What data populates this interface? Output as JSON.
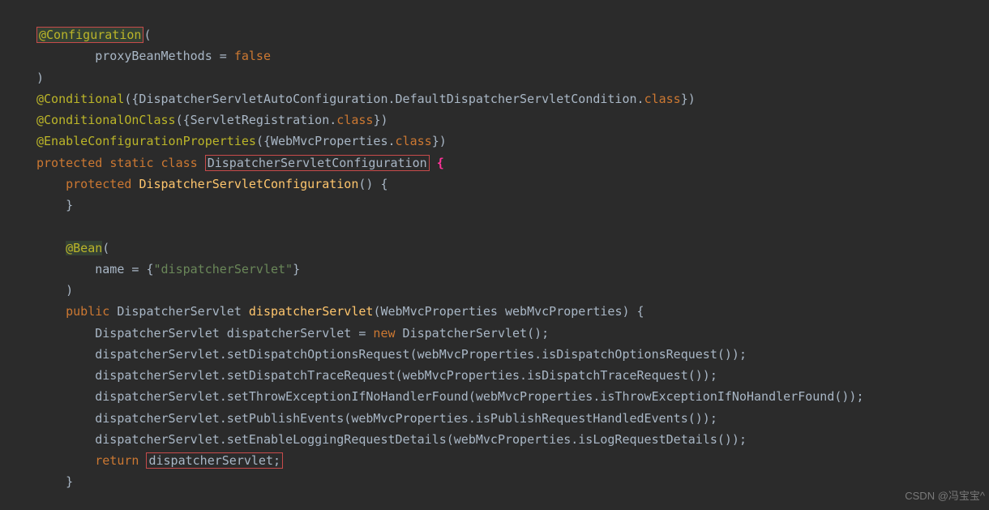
{
  "line1": {
    "annotation": "@Configuration",
    "paren": "("
  },
  "line2": {
    "indent": "        ",
    "prop": "proxyBeanMethods = ",
    "value": "false"
  },
  "line3": {
    "paren": ")"
  },
  "line4": {
    "annotation": "@Conditional",
    "rest": "({DispatcherServletAutoConfiguration.DefaultDispatcherServletCondition.",
    "cls": "class",
    "close": "})"
  },
  "line5": {
    "annotation": "@ConditionalOnClass",
    "rest": "({ServletRegistration.",
    "cls": "class",
    "close": "})"
  },
  "line6": {
    "annotation": "@EnableConfigurationProperties",
    "rest": "({WebMvcProperties.",
    "cls": "class",
    "close": "})"
  },
  "line7": {
    "kw1": "protected",
    "kw2": "static",
    "kw3": "class",
    "name": "DispatcherServletConfiguration",
    "brace": "{"
  },
  "line8": {
    "indent": "    ",
    "kw": "protected",
    "method": "DispatcherServletConfiguration",
    "rest": "() {"
  },
  "line9": {
    "indent": "    ",
    "brace": "}"
  },
  "line11": {
    "indent": "    ",
    "annotation": "@Bean",
    "paren": "("
  },
  "line12": {
    "indent": "        ",
    "prop": "name = {",
    "str": "\"dispatcherServlet\"",
    "close": "}"
  },
  "line13": {
    "indent": "    ",
    "paren": ")"
  },
  "line14": {
    "indent": "    ",
    "kw": "public",
    "type": "DispatcherServlet",
    "method": "dispatcherServlet",
    "params": "(WebMvcProperties webMvcProperties) {"
  },
  "line15": {
    "indent": "        ",
    "type": "DispatcherServlet dispatcherServlet = ",
    "kw": "new",
    "rest": " DispatcherServlet();"
  },
  "line16": {
    "indent": "        ",
    "text": "dispatcherServlet.setDispatchOptionsRequest(webMvcProperties.isDispatchOptionsRequest());"
  },
  "line17": {
    "indent": "        ",
    "text": "dispatcherServlet.setDispatchTraceRequest(webMvcProperties.isDispatchTraceRequest());"
  },
  "line18": {
    "indent": "        ",
    "text": "dispatcherServlet.setThrowExceptionIfNoHandlerFound(webMvcProperties.isThrowExceptionIfNoHandlerFound());"
  },
  "line19": {
    "indent": "        ",
    "text": "dispatcherServlet.setPublishEvents(webMvcProperties.isPublishRequestHandledEvents());"
  },
  "line20": {
    "indent": "        ",
    "text": "dispatcherServlet.setEnableLoggingRequestDetails(webMvcProperties.isLogRequestDetails());"
  },
  "line21": {
    "indent": "        ",
    "kw": "return",
    "val": "dispatcherServlet;"
  },
  "line22": {
    "indent": "    ",
    "brace": "}"
  },
  "watermark": "CSDN @冯宝宝^"
}
